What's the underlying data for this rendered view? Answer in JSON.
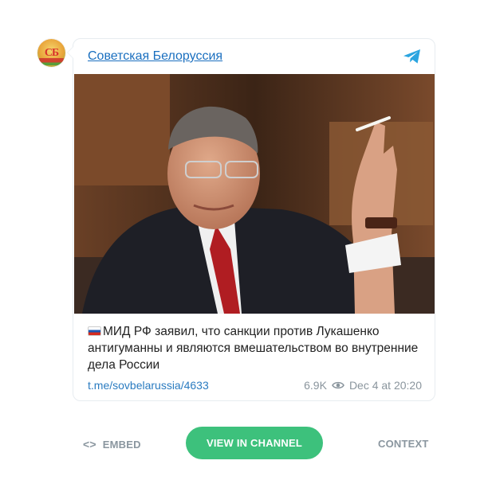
{
  "channel": {
    "name": "Советская Белоруссия",
    "avatar_letters": "СБ"
  },
  "post": {
    "text": "МИД РФ заявил, что санкции против Лукашенко антигуманны и являются вмешательством во внутренние дела России",
    "link": "t.me/sovbelarussia/4633",
    "views": "6.9K",
    "date": "Dec 4 at 20:20"
  },
  "footer": {
    "embed_label": "EMBED",
    "view_label": "VIEW IN CHANNEL",
    "context_label": "CONTEXT"
  },
  "colors": {
    "accent_green": "#3dc17c",
    "link_blue": "#2a7bc0",
    "telegram_blue": "#2ca5e0"
  },
  "icons": [
    "telegram-icon",
    "eye-icon",
    "code-icon",
    "flag-russia-icon"
  ]
}
